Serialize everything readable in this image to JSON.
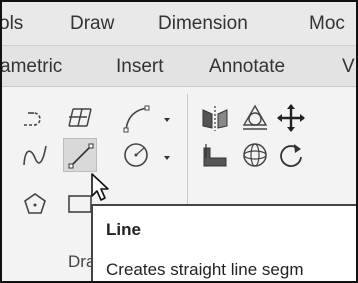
{
  "menubar": {
    "items": [
      "ols",
      "Draw",
      "Dimension",
      "Moc"
    ]
  },
  "ribbon_tabs": {
    "items": [
      "ametric",
      "Insert",
      "Annotate",
      "V"
    ]
  },
  "panel": {
    "group_label": "Dra"
  },
  "tooltip": {
    "title": "Line",
    "description": "Creates straight line segm"
  },
  "icons": {
    "row1": [
      "polyline-icon",
      "table-icon",
      "arc-icon",
      "mirror-icon",
      "3d-orbit-icon",
      "move-icon"
    ],
    "row2": [
      "spline-icon",
      "line-icon",
      "circle-icon",
      "layer-icon",
      "sphere-icon",
      "rotate-icon"
    ],
    "row3": [
      "polygon-icon",
      "rectangle-icon"
    ]
  }
}
